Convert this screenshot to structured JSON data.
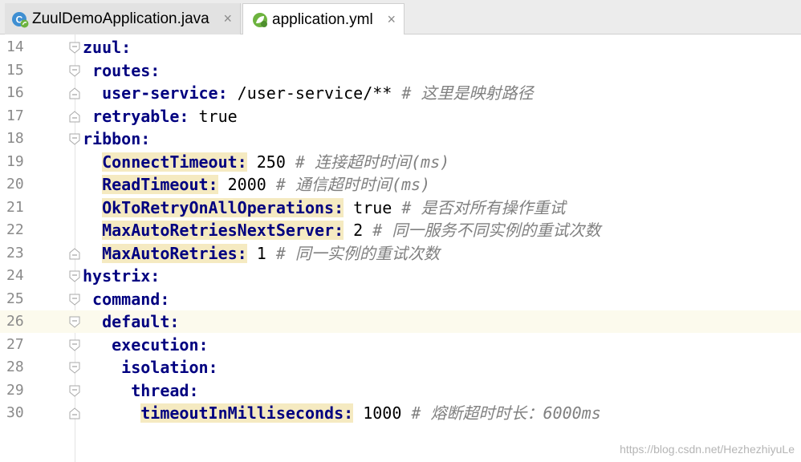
{
  "tabs": [
    {
      "label": "ZuulDemoApplication.java",
      "icon": "spring-java-class-icon",
      "close": "×"
    },
    {
      "label": "application.yml",
      "icon": "spring-yml-leaf-icon",
      "close": "×",
      "active": true
    }
  ],
  "current_line": 26,
  "lines": [
    {
      "n": "14",
      "fold": "start",
      "indent": "",
      "key": "zuul",
      "colon": ":",
      "hl": false,
      "value": "",
      "comment": ""
    },
    {
      "n": "15",
      "fold": "start",
      "indent": " ",
      "key": "routes",
      "colon": ":",
      "hl": false,
      "value": "",
      "comment": ""
    },
    {
      "n": "16",
      "fold": "end",
      "indent": "  ",
      "key": "user-service",
      "colon": ":",
      "hl": false,
      "value": " /user-service/**",
      "comment": " # 这里是映射路径"
    },
    {
      "n": "17",
      "fold": "end",
      "indent": " ",
      "key": "retryable",
      "colon": ":",
      "hl": false,
      "value": " true",
      "comment": ""
    },
    {
      "n": "18",
      "fold": "start",
      "indent": "",
      "key": "ribbon",
      "colon": ":",
      "hl": false,
      "value": "",
      "comment": ""
    },
    {
      "n": "19",
      "fold": "",
      "indent": "  ",
      "key": "ConnectTimeout",
      "colon": ":",
      "hl": true,
      "value": " 250",
      "comment": " # 连接超时时间(ms)"
    },
    {
      "n": "20",
      "fold": "",
      "indent": "  ",
      "key": "ReadTimeout",
      "colon": ":",
      "hl": true,
      "value": " 2000",
      "comment": " # 通信超时时间(ms)"
    },
    {
      "n": "21",
      "fold": "",
      "indent": "  ",
      "key": "OkToRetryOnAllOperations",
      "colon": ":",
      "hl": true,
      "value": " true",
      "comment": " # 是否对所有操作重试"
    },
    {
      "n": "22",
      "fold": "",
      "indent": "  ",
      "key": "MaxAutoRetriesNextServer",
      "colon": ":",
      "hl": true,
      "value": " 2",
      "comment": " # 同一服务不同实例的重试次数"
    },
    {
      "n": "23",
      "fold": "end",
      "indent": "  ",
      "key": "MaxAutoRetries",
      "colon": ":",
      "hl": true,
      "value": " 1",
      "comment": " # 同一实例的重试次数"
    },
    {
      "n": "24",
      "fold": "start",
      "indent": "",
      "key": "hystrix",
      "colon": ":",
      "hl": false,
      "value": "",
      "comment": ""
    },
    {
      "n": "25",
      "fold": "start",
      "indent": " ",
      "key": "command",
      "colon": ":",
      "hl": false,
      "value": "",
      "comment": ""
    },
    {
      "n": "26",
      "fold": "start",
      "indent": "  ",
      "key": "default",
      "colon": ":",
      "hl": false,
      "value": "",
      "comment": ""
    },
    {
      "n": "27",
      "fold": "start",
      "indent": "   ",
      "key": "execution",
      "colon": ":",
      "hl": false,
      "value": "",
      "comment": ""
    },
    {
      "n": "28",
      "fold": "start",
      "indent": "    ",
      "key": "isolation",
      "colon": ":",
      "hl": false,
      "value": "",
      "comment": ""
    },
    {
      "n": "29",
      "fold": "start",
      "indent": "     ",
      "key": "thread",
      "colon": ":",
      "hl": false,
      "value": "",
      "comment": ""
    },
    {
      "n": "30",
      "fold": "end",
      "indent": "      ",
      "key": "timeoutInMilliseconds",
      "colon": ":",
      "hl": true,
      "value": " 1000",
      "comment": " # 熔断超时时长：6000ms"
    }
  ],
  "watermark": "https://blog.csdn.net/HezhezhiyuLe",
  "colors": {
    "key": "#000080",
    "comment": "#808080",
    "highlight": "#f5eac1",
    "current_line": "#fcfaed"
  }
}
